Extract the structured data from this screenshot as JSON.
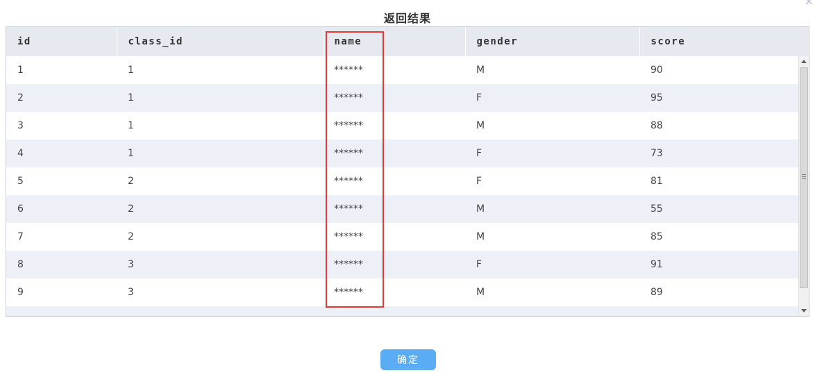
{
  "dialog": {
    "title": "返回结果",
    "close_glyph": "×",
    "confirm_label": "确定"
  },
  "table": {
    "columns": [
      "id",
      "class_id",
      "name",
      "gender",
      "score"
    ],
    "rows": [
      [
        "1",
        "1",
        "******",
        "M",
        "90"
      ],
      [
        "2",
        "1",
        "******",
        "F",
        "95"
      ],
      [
        "3",
        "1",
        "******",
        "M",
        "88"
      ],
      [
        "4",
        "1",
        "******",
        "F",
        "73"
      ],
      [
        "5",
        "2",
        "******",
        "F",
        "81"
      ],
      [
        "6",
        "2",
        "******",
        "M",
        "55"
      ],
      [
        "7",
        "2",
        "******",
        "M",
        "85"
      ],
      [
        "8",
        "3",
        "******",
        "F",
        "91"
      ],
      [
        "9",
        "3",
        "******",
        "M",
        "89"
      ]
    ],
    "highlighted_column": "name"
  },
  "colors": {
    "header_bg": "#e6e9f0",
    "striped_row_bg": "#eef0f7",
    "highlight_border": "#e53935",
    "button_bg": "#5aacf5"
  },
  "icons": {
    "close": "close-icon",
    "scroll_up": "arrow-up-icon",
    "scroll_down": "arrow-down-icon"
  }
}
